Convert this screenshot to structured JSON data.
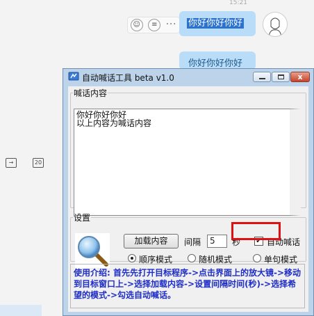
{
  "chat": {
    "timestamp": "15:21",
    "message_1": "你好你好你好",
    "message_2": "你好你好你好",
    "toolbar_icon_date": "20"
  },
  "window": {
    "title": "自动喊话工具 beta v1.0",
    "controls": {
      "close": "x"
    }
  },
  "content_group": {
    "legend": "喊话内容",
    "text_lines": [
      "你好你好你好",
      "以上内容为喊话内容"
    ]
  },
  "settings_group": {
    "legend": "设置",
    "load_button": "加载内容",
    "interval_label": "间隔",
    "interval_value": "5",
    "seconds_label": "秒",
    "auto_label": "自动喊话",
    "auto_checked": true,
    "modes": [
      {
        "label": "顺序模式",
        "selected": true
      },
      {
        "label": "随机模式",
        "selected": false
      },
      {
        "label": "单句模式",
        "selected": false
      }
    ]
  },
  "intro": {
    "text": "使用介绍: 首先先打开目标程序->点击界面上的放大镜->移动到目标窗口上->选择加载内容->设置间隔时间(秒)->选择希望的模式->勾选自动喊话。"
  },
  "colors": {
    "window_frame": "#bcd3ea",
    "intro_text": "#1e2dc8",
    "highlight": "#dd1111",
    "bubble": "#b9dcf8"
  }
}
